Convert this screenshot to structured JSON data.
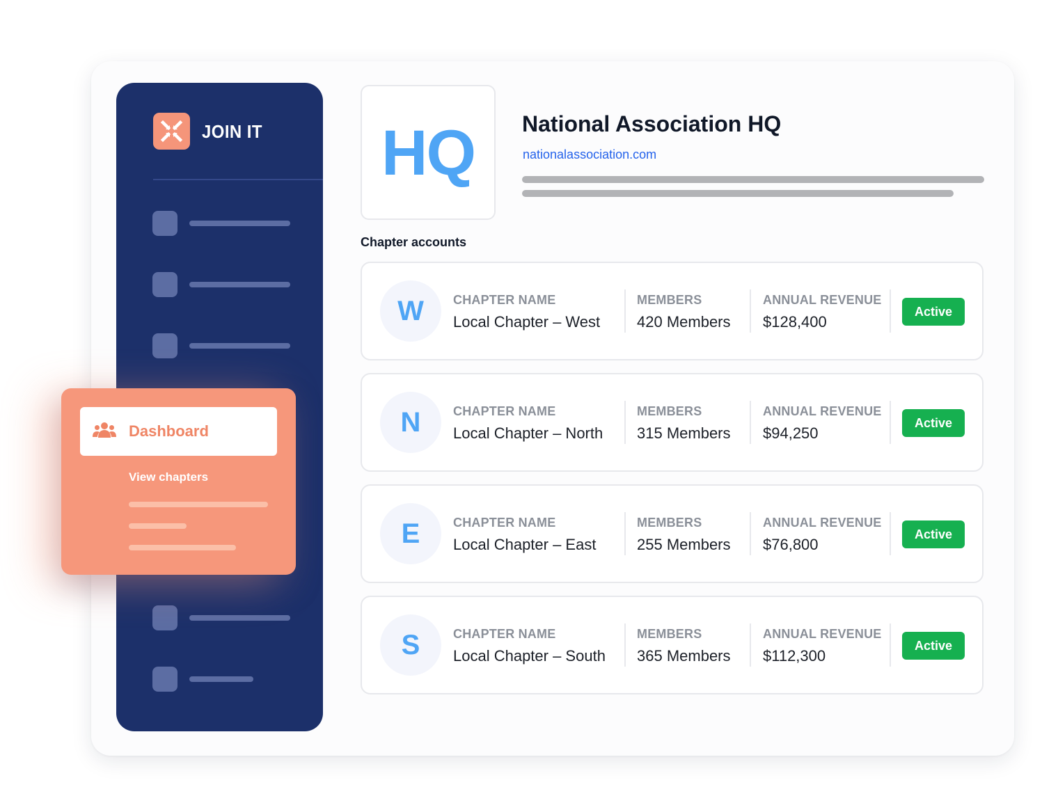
{
  "brand": {
    "name": "JOIN IT",
    "logo_icon": "join-it-logo-icon",
    "accent": "#f5957a"
  },
  "sidebar": {
    "background": "#1c306a"
  },
  "menu": {
    "active_label": "Dashboard",
    "active_icon": "users-icon",
    "sub_label": "View chapters"
  },
  "org": {
    "logo_text": "HQ",
    "name": "National Association HQ",
    "url": "nationalassociation.com"
  },
  "section_title": "Chapter accounts",
  "chapters": [
    {
      "initial": "W",
      "name_label": "CHAPTER NAME",
      "name": "Local Chapter – West",
      "members_label": "MEMBERS",
      "members": "420 Members",
      "revenue_label": "ANNUAL REVENUE",
      "revenue": "$128,400",
      "status": "Active"
    },
    {
      "initial": "N",
      "name_label": "CHAPTER NAME",
      "name": "Local Chapter – North",
      "members_label": "MEMBERS",
      "members": "315 Members",
      "revenue_label": "ANNUAL REVENUE",
      "revenue": "$94,250",
      "status": "Active"
    },
    {
      "initial": "E",
      "name_label": "CHAPTER NAME",
      "name": "Local Chapter – East",
      "members_label": "MEMBERS",
      "members": "255 Members",
      "revenue_label": "ANNUAL REVENUE",
      "revenue": "$76,800",
      "status": "Active"
    },
    {
      "initial": "S",
      "name_label": "CHAPTER NAME",
      "name": "Local Chapter – South",
      "members_label": "MEMBERS",
      "members": "365 Members",
      "revenue_label": "ANNUAL REVENUE",
      "revenue": "$112,300",
      "status": "Active"
    }
  ],
  "colors": {
    "status_active": "#16b050",
    "link": "#2563eb",
    "avatar_text": "#4fa5f5"
  }
}
